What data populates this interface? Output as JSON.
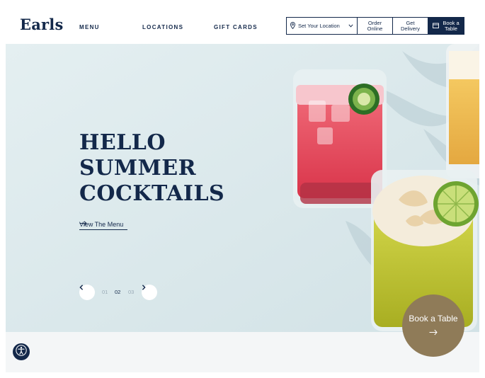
{
  "brand": {
    "logo": "Earls"
  },
  "nav": {
    "items": [
      "MENU",
      "LOCATIONS",
      "GIFT CARDS"
    ]
  },
  "actions": {
    "location": "Set Your Location",
    "order_line1": "Order",
    "order_line2": "Online",
    "delivery_line1": "Get",
    "delivery_line2": "Delivery",
    "book_line1": "Book a",
    "book_line2": "Table"
  },
  "hero": {
    "headline": [
      "HELLO",
      "SUMMER",
      "COCKTAILS"
    ],
    "cta": "View The Menu",
    "pagination": [
      "01",
      "02",
      "03"
    ],
    "active_page": "02"
  },
  "fab": {
    "label": "Book a Table"
  },
  "colors": {
    "navy": "#13284a",
    "gold": "#8f7b58",
    "hero_bg": "#deebee"
  },
  "icons": [
    "location-pin-icon",
    "chevron-down-icon",
    "calendar-icon",
    "arrow-right-icon",
    "chevron-left-icon",
    "chevron-right-icon",
    "accessibility-icon"
  ]
}
